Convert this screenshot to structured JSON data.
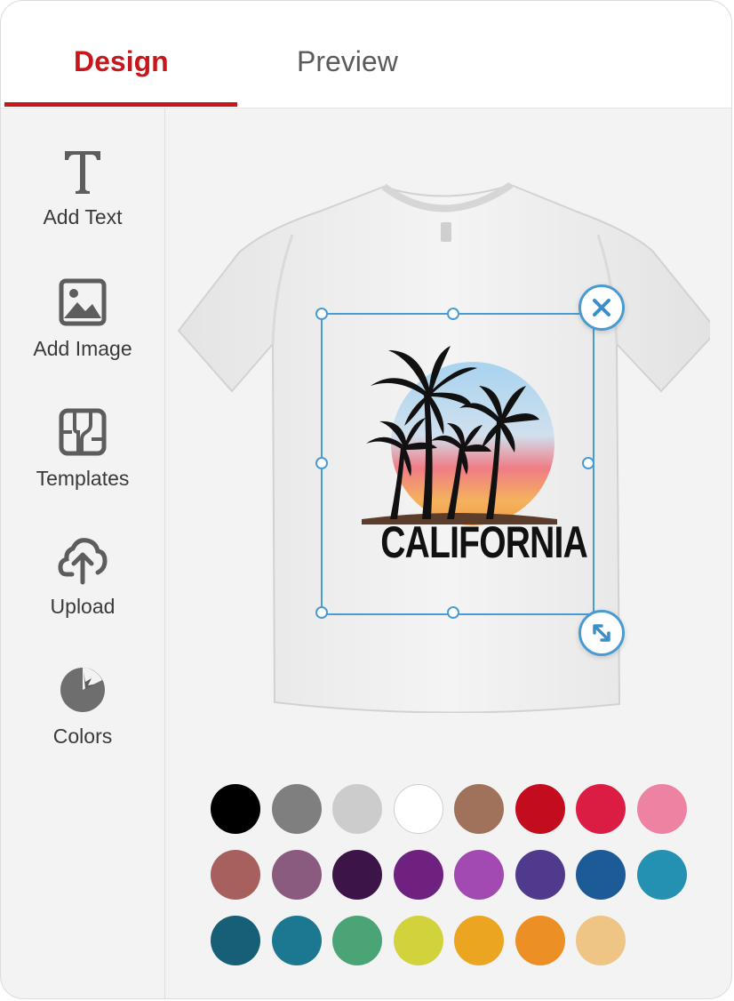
{
  "tabs": {
    "design_label": "Design",
    "preview_label": "Preview",
    "active": "Design"
  },
  "sidebar": {
    "items": [
      {
        "label": "Add Text",
        "icon": "text-icon"
      },
      {
        "label": "Add Image",
        "icon": "image-icon"
      },
      {
        "label": "Templates",
        "icon": "templates-icon"
      },
      {
        "label": "Upload",
        "icon": "upload-icon"
      },
      {
        "label": "Colors",
        "icon": "color-wheel-icon"
      }
    ]
  },
  "canvas": {
    "product": "white t-shirt",
    "design_text": "CALIFORNIA",
    "selection_color": "#4a9bd1",
    "controls": [
      "delete-icon",
      "resize-icon"
    ]
  },
  "colors": {
    "accent": "#c8161d",
    "swatches": [
      "#000000",
      "#7f7f7f",
      "#cccccc",
      "#ffffff",
      "#a0725c",
      "#c30d1f",
      "#dc1d43",
      "#ee82a2",
      "#a8605f",
      "#8a5b7f",
      "#3d1447",
      "#6f217f",
      "#a24ab1",
      "#4f3a8e",
      "#1c5b96",
      "#2591b2",
      "#175e77",
      "#1c7891",
      "#4aa476",
      "#d1d23c",
      "#eba521",
      "#ec8f24",
      "#eec585"
    ]
  }
}
